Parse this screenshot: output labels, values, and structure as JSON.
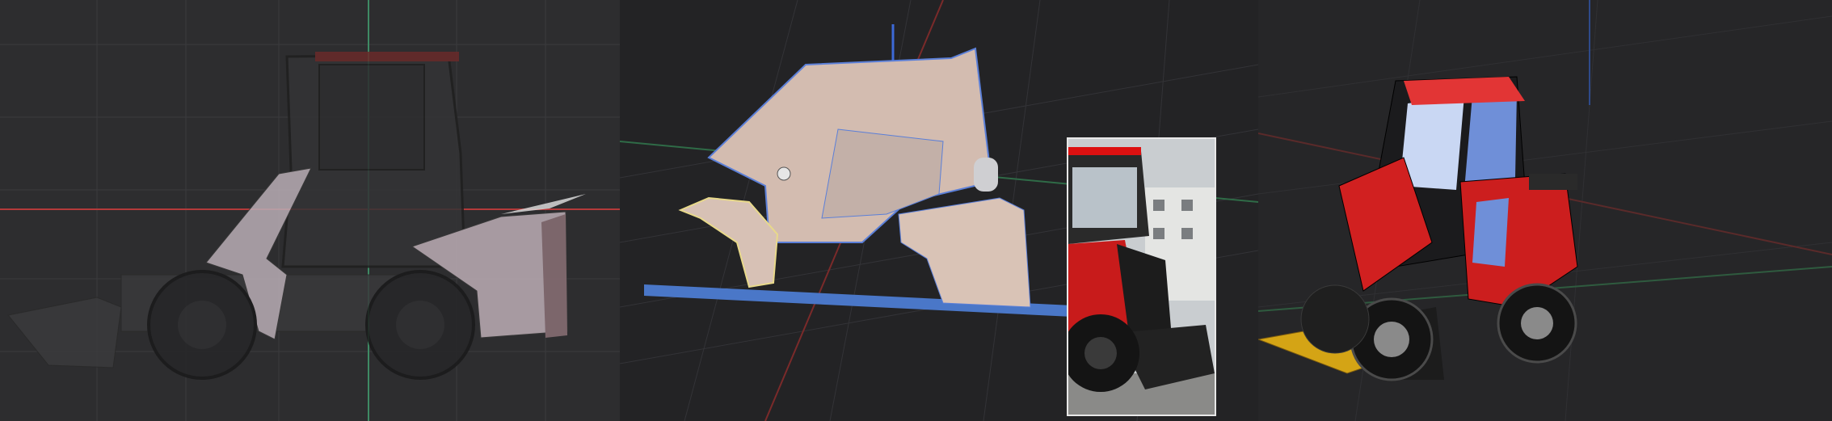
{
  "window": {
    "title": ""
  },
  "colors": {
    "x_axis": "#c63838",
    "y_axis": "#3b7f52",
    "z_axis": "#4a6fd0",
    "selection_outline": "#e8d98a",
    "body_red": "#d81e1e",
    "glass_blue": "#6f8fd8",
    "panel_tan": "#d8bfb2",
    "bucket_gold": "#d8a818"
  },
  "panels": [
    {
      "name": "orthographic-side-view",
      "icon": "wireframe-loader-icon"
    },
    {
      "name": "perspective-modeling-view",
      "icon": "cab-panels-icon"
    },
    {
      "name": "reference-photo",
      "icon": "photo-loader-icon"
    },
    {
      "name": "rendered-perspective-view",
      "icon": "xray-loader-icon"
    }
  ]
}
